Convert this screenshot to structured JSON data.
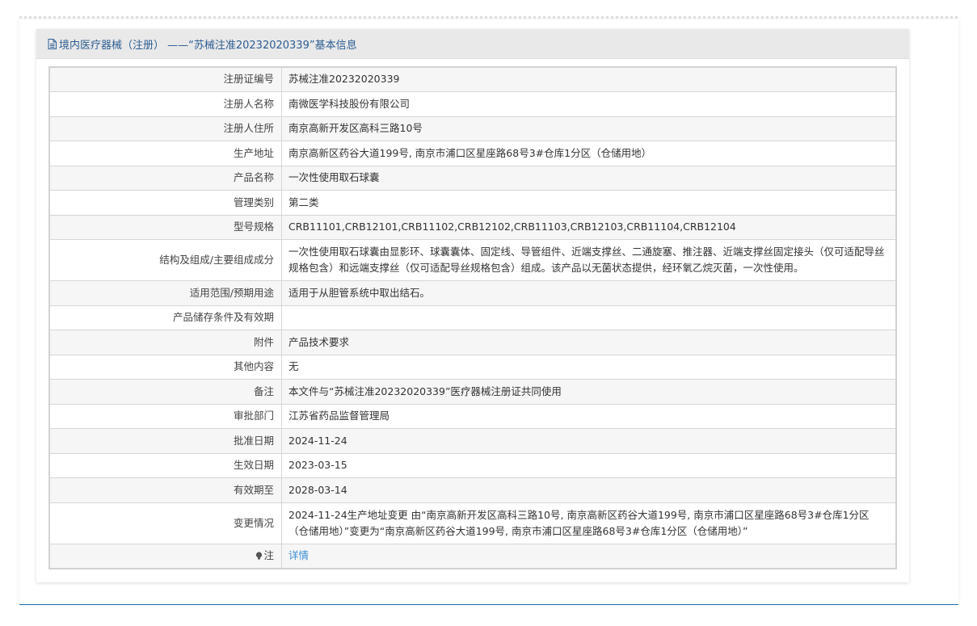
{
  "header": {
    "title": "境内医疗器械（注册） ——“苏械注准20232020339”基本信息"
  },
  "rows": [
    {
      "label": "注册证编号",
      "value": "苏械注准20232020339"
    },
    {
      "label": "注册人名称",
      "value": "南微医学科技股份有限公司"
    },
    {
      "label": "注册人住所",
      "value": "南京高新开发区高科三路10号"
    },
    {
      "label": "生产地址",
      "value": "南京高新区药谷大道199号, 南京市浦口区星座路68号3#仓库1分区（仓储用地）"
    },
    {
      "label": "产品名称",
      "value": "一次性使用取石球囊"
    },
    {
      "label": "管理类别",
      "value": "第二类"
    },
    {
      "label": "型号规格",
      "value": "CRB11101,CRB12101,CRB11102,CRB12102,CRB11103,CRB12103,CRB11104,CRB12104"
    },
    {
      "label": "结构及组成/主要组成成分",
      "value": "一次性使用取石球囊由显影环、球囊囊体、固定线、导管组件、近端支撑丝、二通旋塞、推注器、近端支撑丝固定接头（仅可适配导丝规格包含）和远端支撑丝（仅可适配导丝规格包含）组成。该产品以无菌状态提供，经环氧乙烷灭菌，一次性使用。"
    },
    {
      "label": "适用范围/预期用途",
      "value": "适用于从胆管系统中取出结石。"
    },
    {
      "label": "产品储存条件及有效期",
      "value": ""
    },
    {
      "label": "附件",
      "value": "产品技术要求"
    },
    {
      "label": "其他内容",
      "value": "无"
    },
    {
      "label": "备注",
      "value": "本文件与“苏械注准20232020339”医疗器械注册证共同使用"
    },
    {
      "label": "审批部门",
      "value": "江苏省药品监督管理局"
    },
    {
      "label": "批准日期",
      "value": "2024-11-24"
    },
    {
      "label": "生效日期",
      "value": "2023-03-15"
    },
    {
      "label": "有效期至",
      "value": "2028-03-14"
    },
    {
      "label": "变更情况",
      "value": "2024-11-24生产地址变更 由“南京高新开发区高科三路10号, 南京高新区药谷大道199号, 南京市浦口区星座路68号3#仓库1分区（仓储用地）”变更为“南京高新区药谷大道199号, 南京市浦口区星座路68号3#仓库1分区（仓储用地）”"
    }
  ],
  "note": {
    "label": "注",
    "icon": "lightbulb-icon",
    "link_text": "详情"
  },
  "colors": {
    "header_text": "#2c5d93",
    "link": "#3b8ed5",
    "accent_line": "#1a6fb5"
  }
}
